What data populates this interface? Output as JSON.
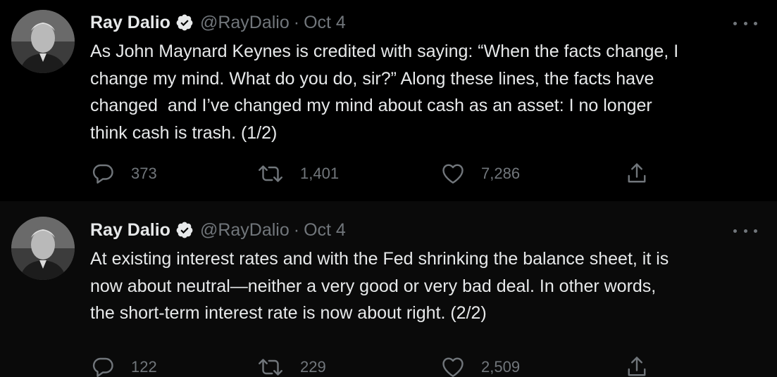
{
  "colors": {
    "background": "#000000",
    "reply_background": "#0a0a0a",
    "text_primary": "#e7e9ea",
    "text_secondary": "#71767b",
    "thread_line": "#3a3d40",
    "verified_badge": "#e7e9ea"
  },
  "tweets": [
    {
      "author": {
        "name": "Ray Dalio",
        "handle": "@RayDalio",
        "verified": true,
        "avatar_icon": "avatar-photo"
      },
      "separator": "·",
      "date": "Oct 4",
      "more_icon": "more-horizontal-icon",
      "text": "As John Maynard Keynes is credited with saying: “When the facts change, I\nchange my mind. What do you do, sir?” Along these lines, the facts have\nchanged  and I’ve changed my mind about cash as an asset: I no longer\nthink cash is trash. (1/2)",
      "actions": {
        "reply": {
          "icon": "reply-icon",
          "count": "373"
        },
        "retweet": {
          "icon": "retweet-icon",
          "count": "1,401"
        },
        "like": {
          "icon": "heart-icon",
          "count": "7,286"
        },
        "share": {
          "icon": "share-icon"
        }
      }
    },
    {
      "author": {
        "name": "Ray Dalio",
        "handle": "@RayDalio",
        "verified": true,
        "avatar_icon": "avatar-photo"
      },
      "separator": "·",
      "date": "Oct 4",
      "more_icon": "more-horizontal-icon",
      "text": "At existing interest rates and with the Fed shrinking the balance sheet, it is\nnow about neutral—neither a very good or very bad deal. In other words,\nthe short-term interest rate is now about right. (2/2)",
      "actions": {
        "reply": {
          "icon": "reply-icon",
          "count": "122"
        },
        "retweet": {
          "icon": "retweet-icon",
          "count": "229"
        },
        "like": {
          "icon": "heart-icon",
          "count": "2,509"
        },
        "share": {
          "icon": "share-icon"
        }
      }
    }
  ]
}
